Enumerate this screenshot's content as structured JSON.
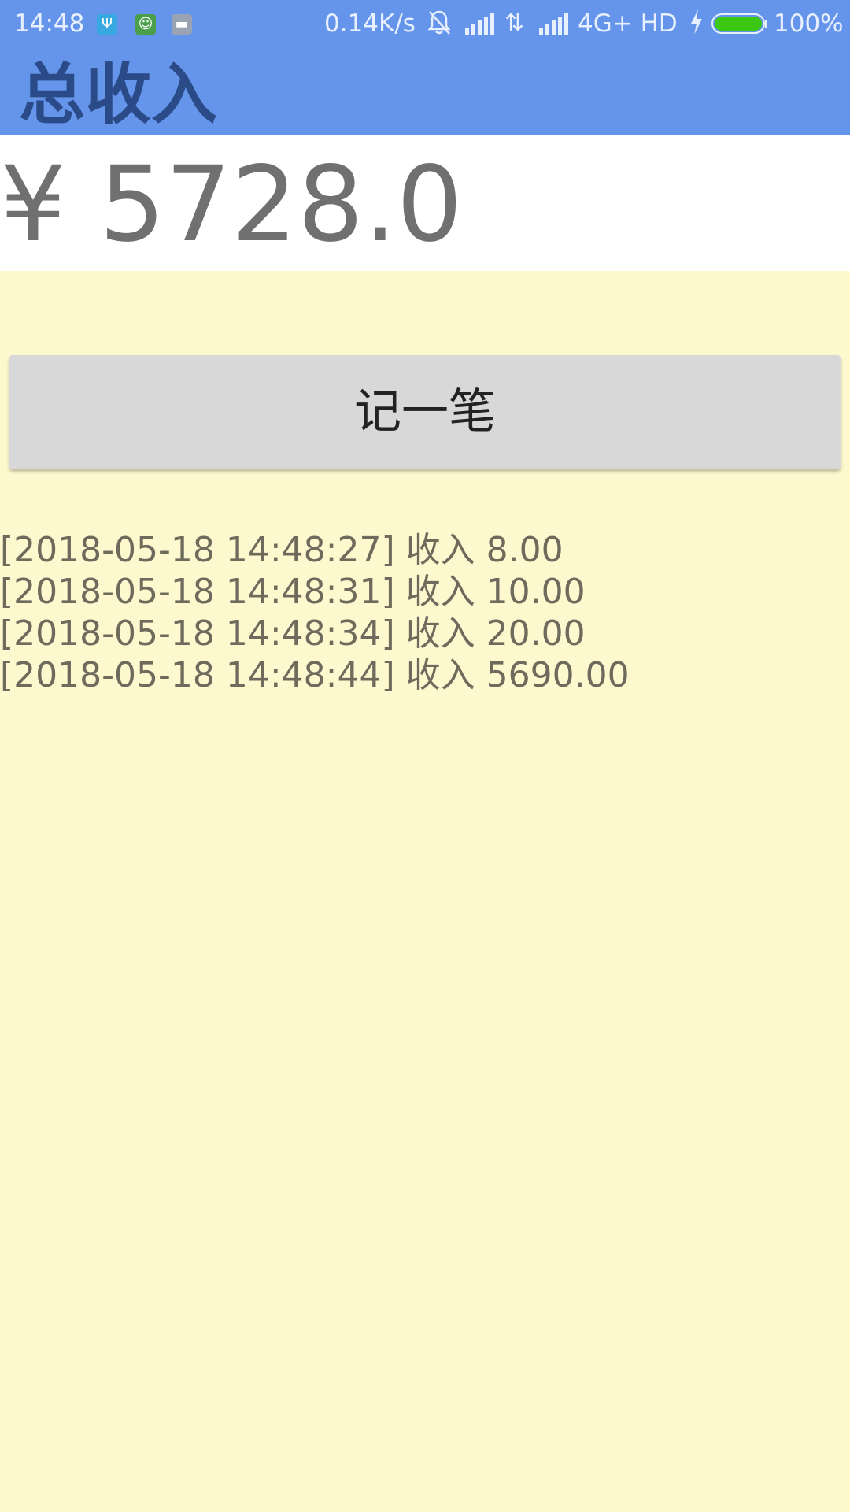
{
  "status_bar": {
    "time": "14:48",
    "app_icons": [
      "usb-debug-icon",
      "android-icon",
      "storage-icon"
    ],
    "network_speed": "0.14K/s",
    "network_type": "4G+ HD",
    "battery_percent": "100%",
    "battery_level": 1.0,
    "battery_color": "#3cc712"
  },
  "app_bar": {
    "title": "总收入",
    "background_color": "#6495ea"
  },
  "total": {
    "amount": "¥ 5728.0"
  },
  "record_button": {
    "label": "记一笔"
  },
  "records": [
    "[2018-05-18 14:48:27] 收入 8.00",
    "[2018-05-18 14:48:31] 收入 10.00",
    "[2018-05-18 14:48:34] 收入 20.00",
    "[2018-05-18 14:48:44] 收入 5690.00"
  ],
  "colors": {
    "page_background": "#fef8cf",
    "record_text": "#6e6b5c"
  }
}
